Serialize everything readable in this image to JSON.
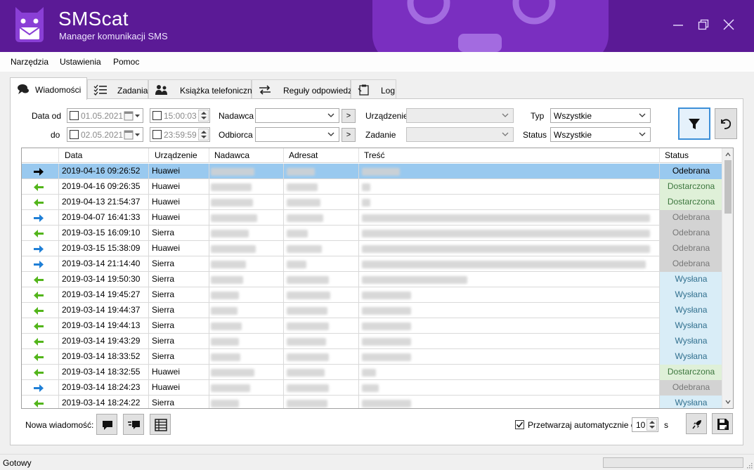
{
  "window": {
    "title": "SMScat",
    "subtitle": "Manager komunikacji SMS",
    "controls": [
      "minimize-icon",
      "restore-icon",
      "close-icon"
    ]
  },
  "menu": [
    "Narzędzia",
    "Ustawienia",
    "Pomoc"
  ],
  "tabs": [
    {
      "label": "Wiadomości",
      "icon": "messages-icon",
      "active": true
    },
    {
      "label": "Zadania",
      "icon": "tasks-icon",
      "active": false
    },
    {
      "label": "Książka telefoniczna",
      "icon": "phonebook-icon",
      "active": false
    },
    {
      "label": "Reguły odpowiedzi",
      "icon": "reply-rules-icon",
      "active": false
    },
    {
      "label": "Log",
      "icon": "log-icon",
      "active": false
    }
  ],
  "filters": {
    "date_from_label": "Data od",
    "date_to_label": "do",
    "date_from": "01.05.2021",
    "time_from": "15:00:03",
    "date_to": "02.05.2021",
    "time_to": "23:59:59",
    "sender_label": "Nadawca",
    "sender_value": "",
    "recipient_label": "Odbiorca",
    "recipient_value": "",
    "browse_label": ">",
    "device_label": "Urządzenie",
    "device_value": "",
    "task_label": "Zadanie",
    "task_value": "",
    "type_label": "Typ",
    "type_value": "Wszystkie",
    "status_label": "Status",
    "status_value": "Wszystkie"
  },
  "grid": {
    "columns": [
      "Data",
      "Urządzenie",
      "Nadawca",
      "Adresat",
      "Treść",
      "Status"
    ],
    "rows": [
      {
        "dir": "in-selected",
        "date": "2019-04-16 09:26:52",
        "device": "Huawei",
        "status": "Odebrana",
        "status_class": "odebrana"
      },
      {
        "dir": "out",
        "date": "2019-04-16 09:26:35",
        "device": "Huawei",
        "status": "Dostarczona",
        "status_class": "dostarczona"
      },
      {
        "dir": "out",
        "date": "2019-04-13 21:54:37",
        "device": "Huawei",
        "status": "Dostarczona",
        "status_class": "dostarczona"
      },
      {
        "dir": "in",
        "date": "2019-04-07 16:41:33",
        "device": "Huawei",
        "status": "Odebrana",
        "status_class": "odebrana"
      },
      {
        "dir": "out",
        "date": "2019-03-15 16:09:10",
        "device": "Sierra",
        "status": "Odebrana",
        "status_class": "odebrana"
      },
      {
        "dir": "in",
        "date": "2019-03-15 15:38:09",
        "device": "Huawei",
        "status": "Odebrana",
        "status_class": "odebrana"
      },
      {
        "dir": "in",
        "date": "2019-03-14 21:14:40",
        "device": "Sierra",
        "status": "Odebrana",
        "status_class": "odebrana"
      },
      {
        "dir": "out",
        "date": "2019-03-14 19:50:30",
        "device": "Sierra",
        "status": "Wysłana",
        "status_class": "wyslana"
      },
      {
        "dir": "out",
        "date": "2019-03-14 19:45:27",
        "device": "Sierra",
        "status": "Wysłana",
        "status_class": "wyslana"
      },
      {
        "dir": "out",
        "date": "2019-03-14 19:44:37",
        "device": "Sierra",
        "status": "Wysłana",
        "status_class": "wyslana"
      },
      {
        "dir": "out",
        "date": "2019-03-14 19:44:13",
        "device": "Sierra",
        "status": "Wysłana",
        "status_class": "wyslana"
      },
      {
        "dir": "out",
        "date": "2019-03-14 19:43:29",
        "device": "Sierra",
        "status": "Wysłana",
        "status_class": "wyslana"
      },
      {
        "dir": "out",
        "date": "2019-03-14 18:33:52",
        "device": "Sierra",
        "status": "Wysłana",
        "status_class": "wyslana"
      },
      {
        "dir": "out",
        "date": "2019-03-14 18:32:55",
        "device": "Huawei",
        "status": "Dostarczona",
        "status_class": "dostarczona"
      },
      {
        "dir": "in",
        "date": "2019-03-14 18:24:23",
        "device": "Huawei",
        "status": "Odebrana",
        "status_class": "odebrana"
      },
      {
        "dir": "out",
        "date": "2019-03-14 18:24:22",
        "device": "Sierra",
        "status": "Wysłana",
        "status_class": "wyslana"
      }
    ]
  },
  "bottom": {
    "new_message_label": "Nowa wiadomość:",
    "auto_process_label": "Przetwarzaj automatycznie co",
    "auto_process_checked": true,
    "interval_value": "10",
    "interval_unit": "s"
  },
  "statusbar": {
    "text": "Gotowy"
  },
  "colors": {
    "titlebar": "#5b1a96",
    "selected_row": "#99c9ef",
    "arrow_out": "#53b51b",
    "arrow_in": "#1f7fd6"
  }
}
